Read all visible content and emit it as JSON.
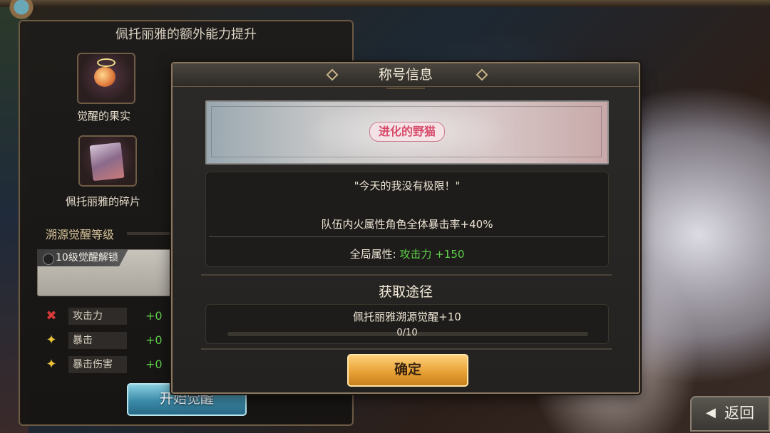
{
  "left_panel": {
    "title": "佩托丽雅的额外能力提升",
    "items": [
      {
        "label": "觉醒的果实",
        "icon": "fruit-icon"
      },
      {
        "label": "佩托丽雅的碎片",
        "icon": "card-shard-icon"
      }
    ],
    "section_title": "溯源觉醒等级",
    "unlock_label": "10级觉醒解锁",
    "stats": [
      {
        "name": "攻击力",
        "value": "+0",
        "icon": "attack-icon",
        "glyph": "✖",
        "color": "#d83a3a"
      },
      {
        "name": "暴击",
        "value": "+0",
        "icon": "crit-icon",
        "glyph": "✦",
        "color": "#e8c23a"
      },
      {
        "name": "暴击伤害",
        "value": "+0",
        "icon": "crit-damage-icon",
        "glyph": "✦",
        "color": "#e8c23a"
      }
    ],
    "start_button": "开始觉醒"
  },
  "dialog": {
    "title": "称号信息",
    "badge": "进化的野猫",
    "quote": "\"今天的我没有极限！\"",
    "effect": "队伍内火属性角色全体暴击率+40%",
    "global_label": "全局属性:",
    "global_value": "攻击力 +150",
    "source_title": "获取途径",
    "source_name": "佩托丽雅溯源觉醒+10",
    "progress_text": "0/10",
    "progress_fraction": 0,
    "confirm": "确定"
  },
  "back_button": {
    "arrow": "◀",
    "label": "返回"
  },
  "colors": {
    "green": "#5ecf4a",
    "gold": "#e8a236",
    "accent_blue": "#3a8aa8"
  }
}
